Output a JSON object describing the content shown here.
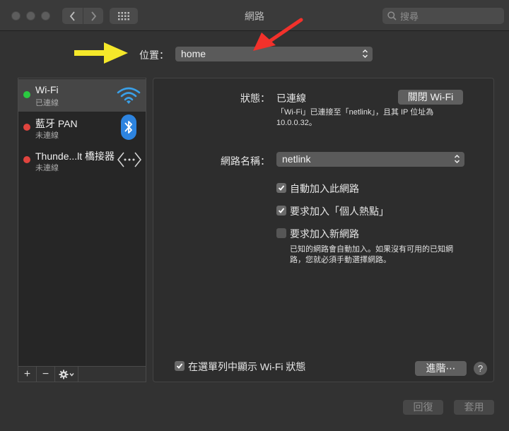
{
  "window": {
    "title": "網路"
  },
  "toolbar": {
    "back_icon": "chevron-left-icon",
    "forward_icon": "chevron-right-icon",
    "show_all_icon": "grid-icon",
    "search_placeholder": "搜尋"
  },
  "location": {
    "label": "位置：",
    "value": "home"
  },
  "services": [
    {
      "name": "Wi-Fi",
      "status": "已連線",
      "status_color": "#2ac940",
      "icon": "wifi-icon",
      "selected": true
    },
    {
      "name": "藍牙 PAN",
      "status": "未連線",
      "status_color": "#e0443e",
      "icon": "bluetooth-icon",
      "selected": false
    },
    {
      "name": "Thunde...lt 橋接器",
      "status": "未連線",
      "status_color": "#e0443e",
      "icon": "thunderbolt-bridge-icon",
      "selected": false
    }
  ],
  "sidebar_footer": {
    "add": "+",
    "remove": "−",
    "actions_icon": "gear-icon"
  },
  "detail": {
    "status_label": "狀態：",
    "status_value": "已連線",
    "turn_off_button": "關閉 Wi-Fi",
    "status_description": "「Wi-Fi」已連接至「netlink」，且其 IP 位址為 10.0.0.32。",
    "network_name_label": "網路名稱：",
    "network_name_value": "netlink",
    "auto_join": {
      "label": "自動加入此網路",
      "checked": true
    },
    "ask_hotspots": {
      "label": "要求加入「個人熱點」",
      "checked": true
    },
    "ask_new_networks": {
      "label": "要求加入新網路",
      "checked": false
    },
    "ask_new_description": "已知的網路會自動加入。如果沒有可用的已知網路，您就必須手動選擇網路。",
    "show_in_menubar": {
      "label": "在選單列中顯示 Wi-Fi 狀態",
      "checked": true
    },
    "advanced_button": "進階⋯",
    "help": "?"
  },
  "footer": {
    "revert_button": "回復",
    "apply_button": "套用"
  },
  "annotations": {
    "yellow_arrow_color": "#f5e82a",
    "red_arrow_color": "#f2312b"
  }
}
